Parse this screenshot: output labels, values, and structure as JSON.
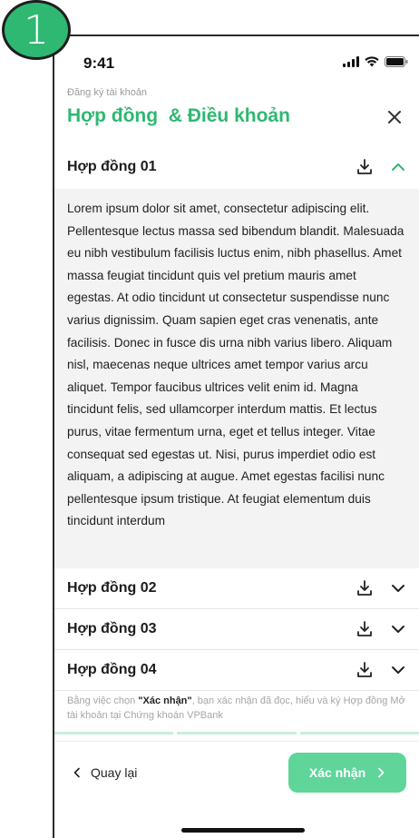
{
  "step_badge": "1",
  "status": {
    "time": "9:41"
  },
  "header": {
    "subtitle": "Đăng ký tài khoản",
    "title": "Hợp đồng  & Điều khoản"
  },
  "contracts": [
    {
      "label": "Hợp đồng 01",
      "expanded": true
    },
    {
      "label": "Hợp đồng 02",
      "expanded": false
    },
    {
      "label": "Hợp đồng 03",
      "expanded": false
    },
    {
      "label": "Hợp đồng 04",
      "expanded": false
    }
  ],
  "contract_text": "Lorem ipsum dolor sit amet, consectetur adipiscing elit. Pellentesque lectus massa sed bibendum blandit. Malesuada eu nibh vestibulum facilisis luctus enim, nibh phasellus. Amet massa feugiat tincidunt quis vel pretium mauris amet egestas. At odio tincidunt ut consectetur suspendisse nunc varius dignissim. Quam sapien eget cras venenatis, ante facilisis. Donec in fusce dis urna nibh varius libero. Aliquam nisl, maecenas neque ultrices amet tempor varius arcu aliquet. Tempor faucibus ultrices velit enim id. Magna tincidunt felis, sed ullamcorper interdum mattis. Et lectus purus, vitae fermentum urna, eget et tellus integer. Vitae consequat sed egestas ut. Nisi, purus imperdiet odio est aliquam, a adipiscing at augue. Amet egestas facilisi nunc pellentesque ipsum tristique. At feugiat elementum duis tincidunt interdum",
  "consent": {
    "prefix": "Bằng việc chọn ",
    "highlight": "\"Xác nhận\"",
    "suffix": ", bạn xác nhận đã đọc, hiểu và ký Hợp đồng Mở tài khoản tại Chứng khoán VPBank"
  },
  "footer": {
    "back_label": "Quay lại",
    "confirm_label": "Xác nhận"
  },
  "icons": {
    "download": "download-icon",
    "chevron_up": "chevron-up-icon",
    "chevron_down": "chevron-down-icon",
    "close": "close-icon",
    "back": "chevron-left-icon",
    "forward": "chevron-right-icon"
  },
  "colors": {
    "brand_green": "#2eb872",
    "button_green": "#5fd59a",
    "body_bg": "#f3f3f3"
  }
}
